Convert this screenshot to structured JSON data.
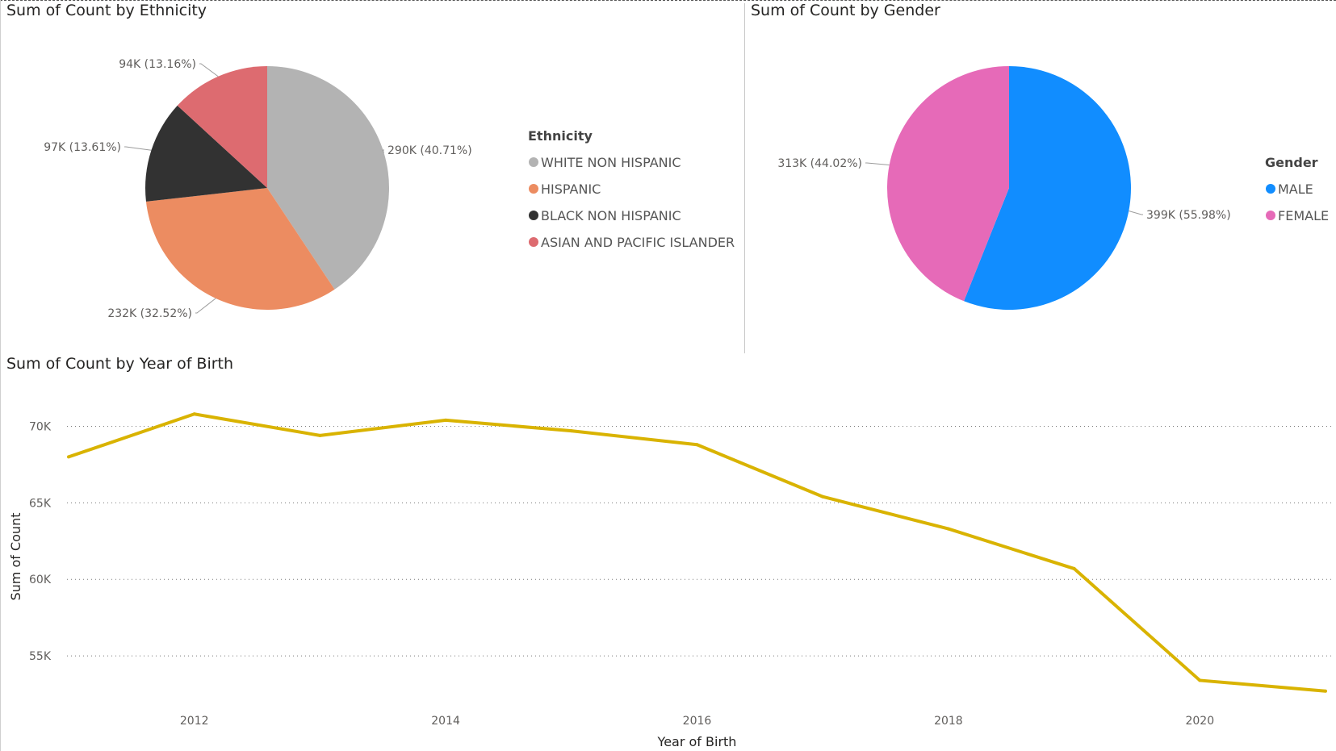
{
  "titles": {
    "ethnicity": "Sum of Count by Ethnicity",
    "gender": "Sum of Count by Gender",
    "year": "Sum of Count by Year of Birth"
  },
  "chart_data": [
    {
      "type": "pie",
      "title": "Sum of Count by Ethnicity",
      "legend_title": "Ethnicity",
      "legend_position": "right",
      "slices": [
        {
          "name": "WHITE NON HISPANIC",
          "value": 290,
          "percent": 40.71,
          "label": "290K (40.71%)",
          "color": "#b3b3b3"
        },
        {
          "name": "HISPANIC",
          "value": 232,
          "percent": 32.52,
          "label": "232K (32.52%)",
          "color": "#ec8c61"
        },
        {
          "name": "BLACK NON HISPANIC",
          "value": 97,
          "percent": 13.61,
          "label": "97K (13.61%)",
          "color": "#323232"
        },
        {
          "name": "ASIAN AND PACIFIC ISLANDER",
          "value": 94,
          "percent": 13.16,
          "label": "94K (13.16%)",
          "color": "#dd6b70"
        }
      ]
    },
    {
      "type": "pie",
      "title": "Sum of Count by Gender",
      "legend_title": "Gender",
      "legend_position": "right",
      "slices": [
        {
          "name": "MALE",
          "value": 399,
          "percent": 55.98,
          "label": "399K (55.98%)",
          "color": "#118dff"
        },
        {
          "name": "FEMALE",
          "value": 313,
          "percent": 44.02,
          "label": "313K (44.02%)",
          "color": "#e66ab8"
        }
      ]
    },
    {
      "type": "line",
      "title": "Sum of Count by Year of Birth",
      "xlabel": "Year of Birth",
      "ylabel": "Sum of Count",
      "x": [
        2011,
        2012,
        2013,
        2014,
        2015,
        2016,
        2017,
        2018,
        2019,
        2020,
        2021
      ],
      "series": [
        {
          "values": [
            68000,
            70800,
            69400,
            70400,
            69700,
            68800,
            65400,
            63300,
            60700,
            53400,
            52700
          ],
          "color": "#d9b300"
        }
      ],
      "xticks": [
        "2012",
        "2014",
        "2016",
        "2018",
        "2020"
      ],
      "yticks": [
        "55K",
        "60K",
        "65K",
        "70K"
      ],
      "ytick_values": [
        55000,
        60000,
        65000,
        70000
      ],
      "xlim": [
        2011,
        2021
      ],
      "ylim": [
        52000,
        71500
      ],
      "grid": "horizontal dotted"
    }
  ]
}
